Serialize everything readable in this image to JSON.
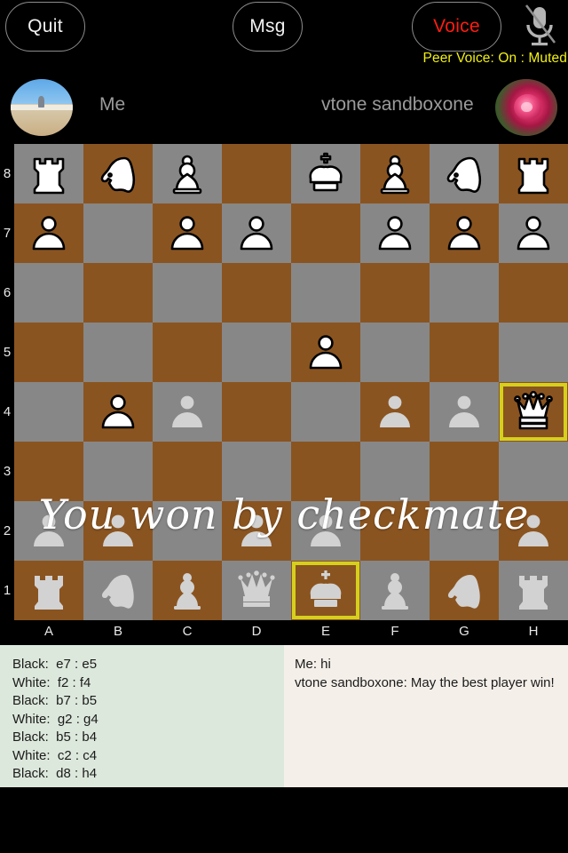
{
  "topbar": {
    "quit_label": "Quit",
    "msg_label": "Msg",
    "voice_label": "Voice",
    "voice_color": "#ff1d11",
    "mic_icon": "microphone-muted-icon",
    "peer_voice_status": "Peer Voice:  On : Muted",
    "peer_voice_color": "#f1f014"
  },
  "players": {
    "me": {
      "name": "Me",
      "avatar": "beach-photo-avatar"
    },
    "peer": {
      "name": "vtone sandboxone",
      "avatar": "rose-photo-avatar"
    }
  },
  "board": {
    "light_color": "#878787",
    "dark_color": "#8a5420",
    "highlight_color": "#d6d01c",
    "files": [
      "A",
      "B",
      "C",
      "D",
      "E",
      "F",
      "G",
      "H"
    ],
    "ranks": [
      "8",
      "7",
      "6",
      "5",
      "4",
      "3",
      "2",
      "1"
    ],
    "selected_squares": [
      "h4",
      "e1"
    ],
    "rows": [
      [
        {
          "square": "a8",
          "piece": "rook",
          "color": "black"
        },
        {
          "square": "b8",
          "piece": "knight",
          "color": "black"
        },
        {
          "square": "c8",
          "piece": "bishop",
          "color": "black"
        },
        {
          "square": "d8",
          "piece": null,
          "color": null
        },
        {
          "square": "e8",
          "piece": "king",
          "color": "black"
        },
        {
          "square": "f8",
          "piece": "bishop",
          "color": "black"
        },
        {
          "square": "g8",
          "piece": "knight",
          "color": "black"
        },
        {
          "square": "h8",
          "piece": "rook",
          "color": "black"
        }
      ],
      [
        {
          "square": "a7",
          "piece": "pawn",
          "color": "black"
        },
        {
          "square": "b7",
          "piece": null,
          "color": null
        },
        {
          "square": "c7",
          "piece": "pawn",
          "color": "black"
        },
        {
          "square": "d7",
          "piece": "pawn",
          "color": "black"
        },
        {
          "square": "e7",
          "piece": null,
          "color": null
        },
        {
          "square": "f7",
          "piece": "pawn",
          "color": "black"
        },
        {
          "square": "g7",
          "piece": "pawn",
          "color": "black"
        },
        {
          "square": "h7",
          "piece": "pawn",
          "color": "black"
        }
      ],
      [
        {
          "square": "a6",
          "piece": null,
          "color": null
        },
        {
          "square": "b6",
          "piece": null,
          "color": null
        },
        {
          "square": "c6",
          "piece": null,
          "color": null
        },
        {
          "square": "d6",
          "piece": null,
          "color": null
        },
        {
          "square": "e6",
          "piece": null,
          "color": null
        },
        {
          "square": "f6",
          "piece": null,
          "color": null
        },
        {
          "square": "g6",
          "piece": null,
          "color": null
        },
        {
          "square": "h6",
          "piece": null,
          "color": null
        }
      ],
      [
        {
          "square": "a5",
          "piece": null,
          "color": null
        },
        {
          "square": "b5",
          "piece": null,
          "color": null
        },
        {
          "square": "c5",
          "piece": null,
          "color": null
        },
        {
          "square": "d5",
          "piece": null,
          "color": null
        },
        {
          "square": "e5",
          "piece": "pawn",
          "color": "black"
        },
        {
          "square": "f5",
          "piece": null,
          "color": null
        },
        {
          "square": "g5",
          "piece": null,
          "color": null
        },
        {
          "square": "h5",
          "piece": null,
          "color": null
        }
      ],
      [
        {
          "square": "a4",
          "piece": null,
          "color": null
        },
        {
          "square": "b4",
          "piece": "pawn",
          "color": "black"
        },
        {
          "square": "c4",
          "piece": "pawn",
          "color": "white"
        },
        {
          "square": "d4",
          "piece": null,
          "color": null
        },
        {
          "square": "e4",
          "piece": null,
          "color": null
        },
        {
          "square": "f4",
          "piece": "pawn",
          "color": "white"
        },
        {
          "square": "g4",
          "piece": "pawn",
          "color": "white"
        },
        {
          "square": "h4",
          "piece": "queen",
          "color": "black"
        }
      ],
      [
        {
          "square": "a3",
          "piece": null,
          "color": null
        },
        {
          "square": "b3",
          "piece": null,
          "color": null
        },
        {
          "square": "c3",
          "piece": null,
          "color": null
        },
        {
          "square": "d3",
          "piece": null,
          "color": null
        },
        {
          "square": "e3",
          "piece": null,
          "color": null
        },
        {
          "square": "f3",
          "piece": null,
          "color": null
        },
        {
          "square": "g3",
          "piece": null,
          "color": null
        },
        {
          "square": "h3",
          "piece": null,
          "color": null
        }
      ],
      [
        {
          "square": "a2",
          "piece": "pawn",
          "color": "white"
        },
        {
          "square": "b2",
          "piece": "pawn",
          "color": "white"
        },
        {
          "square": "c2",
          "piece": null,
          "color": null
        },
        {
          "square": "d2",
          "piece": "pawn",
          "color": "white"
        },
        {
          "square": "e2",
          "piece": "pawn",
          "color": "white"
        },
        {
          "square": "f2",
          "piece": null,
          "color": null
        },
        {
          "square": "g2",
          "piece": null,
          "color": null
        },
        {
          "square": "h2",
          "piece": "pawn",
          "color": "white"
        }
      ],
      [
        {
          "square": "a1",
          "piece": "rook",
          "color": "white"
        },
        {
          "square": "b1",
          "piece": "knight",
          "color": "white"
        },
        {
          "square": "c1",
          "piece": "bishop",
          "color": "white"
        },
        {
          "square": "d1",
          "piece": "queen",
          "color": "white"
        },
        {
          "square": "e1",
          "piece": "king",
          "color": "white"
        },
        {
          "square": "f1",
          "piece": "bishop",
          "color": "white"
        },
        {
          "square": "g1",
          "piece": "knight",
          "color": "white"
        },
        {
          "square": "h1",
          "piece": "rook",
          "color": "white"
        }
      ]
    ]
  },
  "overlay": {
    "message": "You won by checkmate"
  },
  "move_list": [
    "Black:  e7 : e5",
    "White:  f2 : f4",
    "Black:  b7 : b5",
    "White:  g2 : g4",
    "Black:  b5 : b4",
    "White:  c2 : c4",
    "Black:  d8 : h4"
  ],
  "chat_messages": [
    "Me: hi",
    "vtone sandboxone: May the best player win!"
  ]
}
